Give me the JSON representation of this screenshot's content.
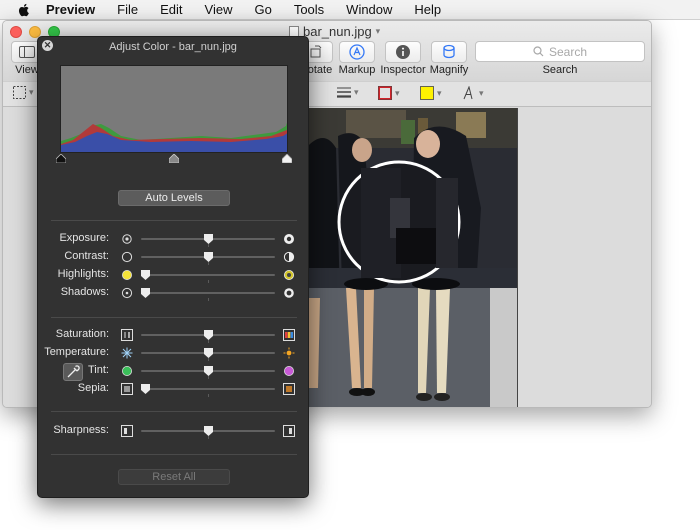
{
  "menubar": {
    "apple_icon": "apple-logo-icon",
    "app_name": "Preview",
    "items": [
      "File",
      "Edit",
      "View",
      "Go",
      "Tools",
      "Window",
      "Help"
    ]
  },
  "window": {
    "document_title": "bar_nun.jpg",
    "toolbar": {
      "view_label": "View",
      "rotate_label": "Rotate",
      "markup_label": "Markup",
      "inspector_label": "Inspector",
      "magnify_label": "Magnify",
      "search_placeholder": "Search",
      "search_label": "Search"
    },
    "accent_color": "#3478f6",
    "border_color_swatch": "#d2232a",
    "fill_color_swatch": "#fff200"
  },
  "hud": {
    "title": "Adjust Color - bar_nun.jpg",
    "auto_levels_label": "Auto Levels",
    "reset_all_label": "Reset All",
    "sliders": {
      "exposure": {
        "label": "Exposure:",
        "value": 0.5
      },
      "contrast": {
        "label": "Contrast:",
        "value": 0.5
      },
      "highlights": {
        "label": "Highlights:",
        "value": 0.0
      },
      "shadows": {
        "label": "Shadows:",
        "value": 0.0
      },
      "saturation": {
        "label": "Saturation:",
        "value": 0.5
      },
      "temperature": {
        "label": "Temperature:",
        "value": 0.5
      },
      "tint": {
        "label": "Tint:",
        "value": 0.5
      },
      "sepia": {
        "label": "Sepia:",
        "value": 0.0
      },
      "sharpness": {
        "label": "Sharpness:",
        "value": 0.5
      }
    },
    "levels": {
      "black_point": 0.0,
      "midtone": 0.5,
      "white_point": 1.0
    }
  }
}
